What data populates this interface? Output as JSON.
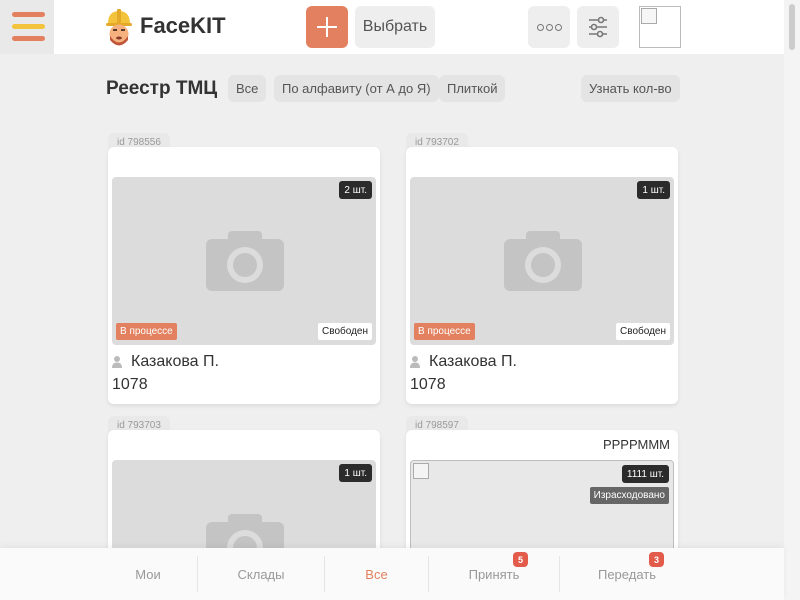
{
  "header": {
    "brand": "FaceKIT",
    "select_label": "Выбрать"
  },
  "toolbar": {
    "title": "Реестр ТМЦ",
    "filter_all": "Все",
    "sort_label": "По алфавиту (от А до Я)",
    "view_label": "Плиткой",
    "count_label": "Узнать кол-во"
  },
  "cards": [
    {
      "id": "id 798556",
      "qty": "2 шт.",
      "status": "В процессе",
      "availability": "Свободен",
      "owner": "Казакова П.",
      "number": "1078"
    },
    {
      "id": "id 793702",
      "qty": "1 шт.",
      "status": "В процессе",
      "availability": "Свободен",
      "owner": "Казакова П.",
      "number": "1078"
    },
    {
      "id": "id 793703",
      "qty": "1 шт."
    },
    {
      "id": "id 798597",
      "title": "РРРРМММ",
      "qty": "1111 шт.",
      "status": "Израсходовано"
    }
  ],
  "bottom_nav": {
    "items": [
      "Мои",
      "Склады",
      "Все",
      "Принять",
      "Передать"
    ],
    "active": "Все",
    "badges": {
      "accept": "5",
      "transfer": "3"
    }
  },
  "colors": {
    "accent": "#e2805f",
    "menu_yellow": "#f3c33c",
    "badge": "#e25b4b"
  },
  "icons": [
    "hamburger-menu-icon",
    "builder-mascot-logo-icon",
    "plus-icon",
    "more-dots-icon",
    "filter-sliders-icon",
    "camera-placeholder-icon",
    "person-icon"
  ]
}
